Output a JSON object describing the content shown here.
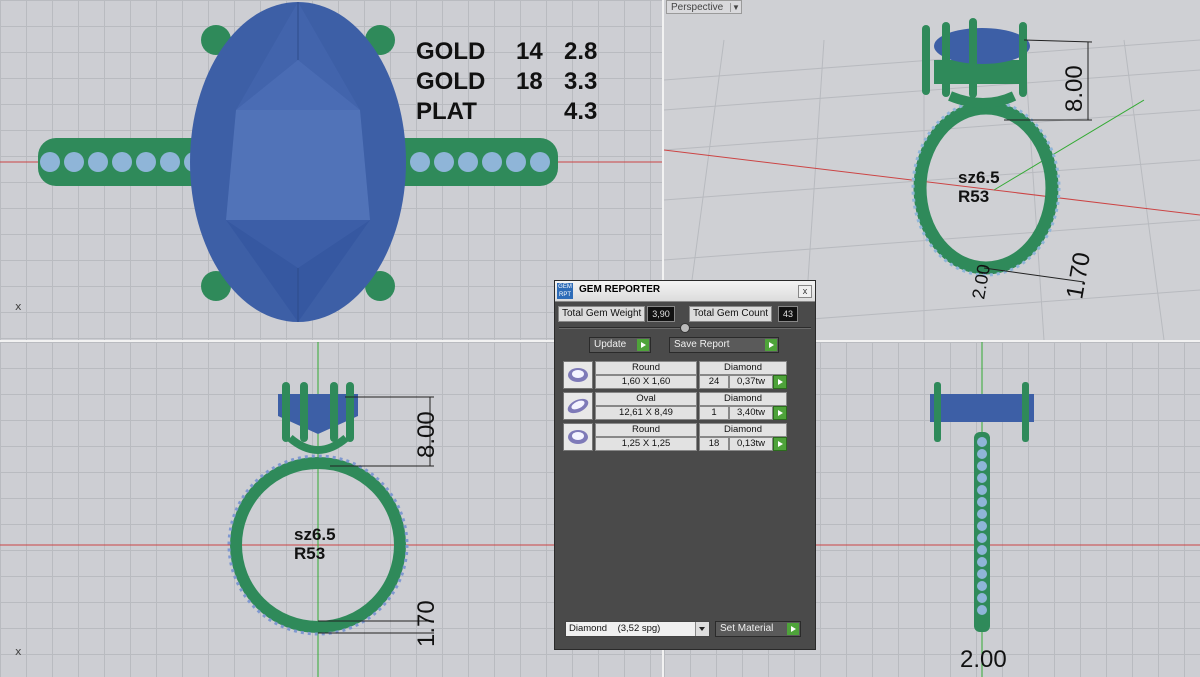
{
  "viewport_top_left": {
    "axis_label": "x",
    "metal_table": [
      {
        "metal": "GOLD",
        "karat": "14",
        "weight": "2.8"
      },
      {
        "metal": "GOLD",
        "karat": "18",
        "weight": "3.3"
      },
      {
        "metal": "PLAT",
        "karat": "",
        "weight": "4.3"
      }
    ]
  },
  "viewport_top_right": {
    "title": "Perspective",
    "dim_height": "8.00",
    "dim_band": "1.70",
    "dim_width": "2.00",
    "size_label": "sz6.5",
    "ring_label": "R53"
  },
  "viewport_bottom_left": {
    "axis_label": "x",
    "dim_height": "8.00",
    "dim_band": "1.70",
    "size_label": "sz6.5",
    "ring_label": "R53"
  },
  "viewport_bottom_right": {
    "dim_width": "2.00"
  },
  "gem_reporter": {
    "title": "GEM REPORTER",
    "close": "x",
    "total_weight_label": "Total Gem Weight",
    "total_weight_value": "3,90",
    "total_count_label": "Total Gem Count",
    "total_count_value": "43",
    "update_label": "Update",
    "save_label": "Save Report",
    "gems": [
      {
        "shape": "Round",
        "size": "1,60 X 1,60",
        "material": "Diamond",
        "count": "24",
        "weight": "0,37tw"
      },
      {
        "shape": "Oval",
        "size": "12,61 X 8,49",
        "material": "Diamond",
        "count": "1",
        "weight": "3,40tw"
      },
      {
        "shape": "Round",
        "size": "1,25 X 1,25",
        "material": "Diamond",
        "count": "18",
        "weight": "0,13tw"
      }
    ],
    "material_select": "Diamond    (3,52 spg)",
    "set_material_label": "Set Material"
  },
  "colors": {
    "metal": "#2f8a5a",
    "stone": "#3f62a8",
    "accent_gem": "#8fb5d8"
  }
}
